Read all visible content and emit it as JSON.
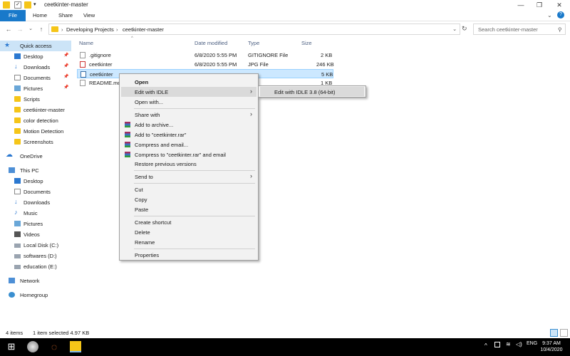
{
  "window": {
    "title": "ceetkinter-master"
  },
  "ribbon": {
    "tabs": [
      "File",
      "Home",
      "Share",
      "View"
    ]
  },
  "address": {
    "crumbs": [
      "Developing Projects",
      "ceetkinter-master"
    ],
    "search_placeholder": "Search ceetkinter-master"
  },
  "nav_pane": {
    "quick_access": "Quick access",
    "quick_items": [
      "Desktop",
      "Downloads",
      "Documents",
      "Pictures",
      "Scripts",
      "ceetkinter-master",
      "color detection",
      "Motion Detection",
      "Screenshots"
    ],
    "onedrive": "OneDrive",
    "this_pc": "This PC",
    "pc_items": [
      "Desktop",
      "Documents",
      "Downloads",
      "Music",
      "Pictures",
      "Videos",
      "Local Disk (C:)",
      "softwares (D:)",
      "education (E:)"
    ],
    "network": "Network",
    "homegroup": "Homegroup"
  },
  "columns": {
    "name": "Name",
    "date": "Date modified",
    "type": "Type",
    "size": "Size"
  },
  "files": [
    {
      "name": ".gitignore",
      "date": "6/8/2020 5:55 PM",
      "type": "GITIGNORE File",
      "size": "2 KB"
    },
    {
      "name": "ceetkinter",
      "date": "6/8/2020 5:55 PM",
      "type": "JPG File",
      "size": "246 KB"
    },
    {
      "name": "ceetkinter",
      "date": "",
      "type": "",
      "size": "5 KB"
    },
    {
      "name": "README.md",
      "date": "",
      "type": "",
      "size": "1 KB"
    }
  ],
  "context_menu": {
    "open": "Open",
    "edit_idle": "Edit with IDLE",
    "open_with": "Open with...",
    "share_with": "Share with",
    "add_archive": "Add to archive...",
    "add_rar": "Add to \"ceetkinter.rar\"",
    "compress_email": "Compress and email...",
    "compress_rar_email": "Compress to \"ceetkinter.rar\" and email",
    "restore": "Restore previous versions",
    "send_to": "Send to",
    "cut": "Cut",
    "copy": "Copy",
    "paste": "Paste",
    "create_shortcut": "Create shortcut",
    "delete": "Delete",
    "rename": "Rename",
    "properties": "Properties"
  },
  "submenu": {
    "item": "Edit with IDLE 3.8 (64-bit)"
  },
  "status": {
    "items": "4 items",
    "selected": "1 item selected  4.97 KB"
  },
  "clock": {
    "time": "9:37 AM",
    "date": "10/4/2020"
  }
}
